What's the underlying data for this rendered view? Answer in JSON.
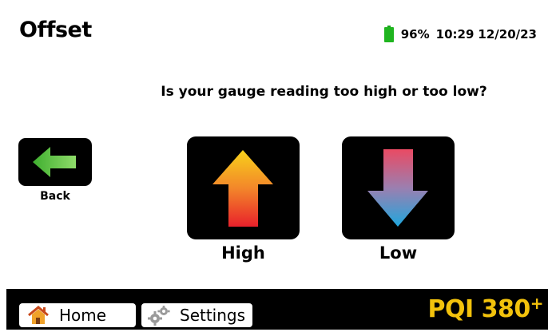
{
  "header": {
    "title": "Offset",
    "battery_percent": "96%",
    "time": "10:29",
    "date": "12/20/23",
    "battery_color": "#1fb51f"
  },
  "main": {
    "question": "Is your gauge reading too high or too low?",
    "back_label": "Back",
    "high_label": "High",
    "low_label": "Low"
  },
  "footer": {
    "home_label": "Home",
    "settings_label": "Settings",
    "brand_text": "PQI 380",
    "brand_superscript": "+",
    "brand_color": "#f2c20c"
  },
  "icons": {
    "back": "left-arrow-icon",
    "high": "up-arrow-icon",
    "low": "down-arrow-icon",
    "home": "home-icon",
    "settings": "gears-icon",
    "battery": "battery-icon"
  }
}
